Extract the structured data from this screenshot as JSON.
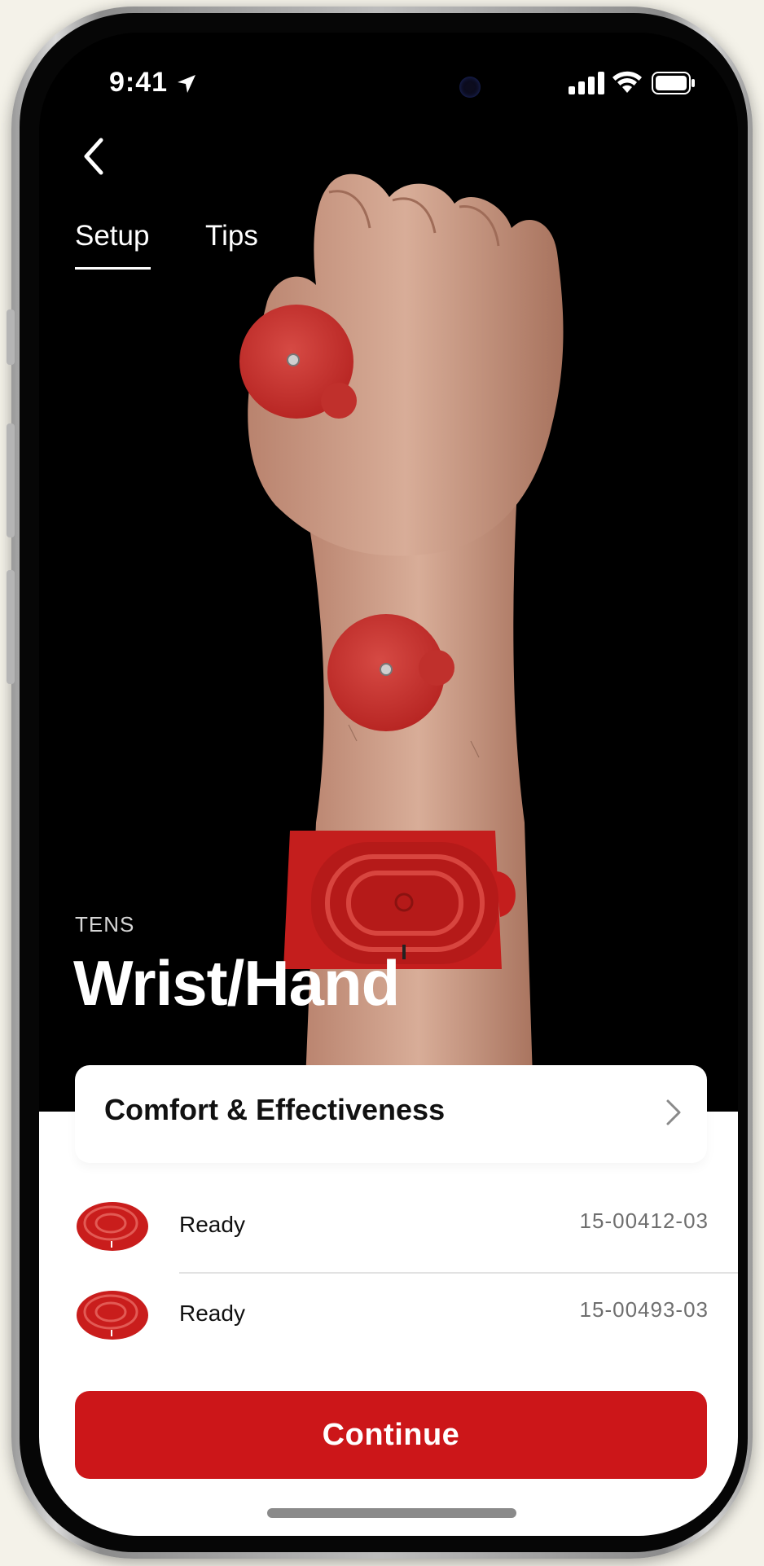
{
  "status_bar": {
    "time": "9:41",
    "icons": [
      "location-arrow-icon",
      "cellular-signal-icon",
      "wifi-icon",
      "battery-icon"
    ]
  },
  "nav": {
    "back_icon": "chevron-left-icon"
  },
  "tabs": [
    {
      "label": "Setup",
      "active": true
    },
    {
      "label": "Tips",
      "active": false
    }
  ],
  "header": {
    "category": "TENS",
    "title": "Wrist/Hand"
  },
  "comfort_card": {
    "label": "Comfort & Effectiveness",
    "icon": "chevron-right-icon"
  },
  "devices": [
    {
      "status": "Ready",
      "serial": "15-00412-03"
    },
    {
      "status": "Ready",
      "serial": "15-00493-03"
    }
  ],
  "continue_button": {
    "label": "Continue"
  },
  "colors": {
    "accent": "#cc1619",
    "background": "#000000",
    "sheet": "#ffffff",
    "serial_text": "#6e6e6e"
  }
}
